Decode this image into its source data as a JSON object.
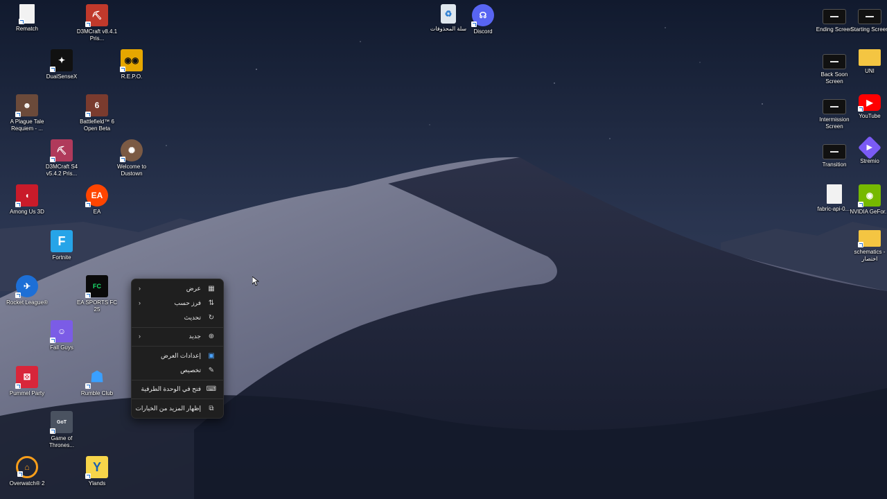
{
  "desktop": {
    "icons": [
      {
        "label": "Rematch",
        "icon": "file-icon"
      },
      {
        "label": "D3MCraft v8.4.1 Pris...",
        "icon": "d3mcraft-icon"
      },
      {
        "label": "DualSenseX",
        "icon": "dualsensex-icon"
      },
      {
        "label": "R.E.P.O.",
        "icon": "repo-icon"
      },
      {
        "label": "A Plague Tale Requiem - ...",
        "icon": "plague-tale-icon"
      },
      {
        "label": "Battlefield™ 6 Open Beta",
        "icon": "battlefield-icon"
      },
      {
        "label": "D3MCraft S4 v5.4.2 Pris...",
        "icon": "d3mcraft-icon"
      },
      {
        "label": "Welcome to Dustown",
        "icon": "dustown-icon"
      },
      {
        "label": "Among Us 3D",
        "icon": "among-us-icon"
      },
      {
        "label": "EA",
        "icon": "ea-icon"
      },
      {
        "label": "Fortnite",
        "icon": "fortnite-icon"
      },
      {
        "label": "Rocket League®",
        "icon": "rocket-league-icon"
      },
      {
        "label": "EA SPORTS FC 25",
        "icon": "fc25-icon"
      },
      {
        "label": "Fall Guys",
        "icon": "fall-guys-icon"
      },
      {
        "label": "Pummel Party",
        "icon": "pummel-party-icon"
      },
      {
        "label": "Rumble Club",
        "icon": "rumble-club-icon"
      },
      {
        "label": "Game of Thrones...",
        "icon": "game-of-thrones-icon"
      },
      {
        "label": "Overwatch® 2",
        "icon": "overwatch-icon"
      },
      {
        "label": "Ylands",
        "icon": "ylands-icon"
      },
      {
        "label": "سلة المحذوفات",
        "icon": "recycle-bin-icon"
      },
      {
        "label": "Discord",
        "icon": "discord-icon"
      },
      {
        "label": "Ending Screen",
        "icon": "video-file-icon"
      },
      {
        "label": "Starting Screen",
        "icon": "video-file-icon"
      },
      {
        "label": "Back Soon Screen",
        "icon": "video-file-icon"
      },
      {
        "label": "UNI",
        "icon": "folder-icon"
      },
      {
        "label": "Intermission Screen",
        "icon": "video-file-icon"
      },
      {
        "label": "YouTube",
        "icon": "youtube-icon"
      },
      {
        "label": "Transition",
        "icon": "video-file-icon"
      },
      {
        "label": "Stremio",
        "icon": "stremio-icon"
      },
      {
        "label": "fabric-api-0....",
        "icon": "file-icon"
      },
      {
        "label": "NVIDIA GeFor...",
        "icon": "nvidia-icon"
      },
      {
        "label": "schematics - اختصار",
        "icon": "folder-icon"
      }
    ]
  },
  "context_menu": {
    "view": "عرض",
    "sort_by": "فرز حسب",
    "refresh": "تحديث",
    "new": "جديد",
    "display_settings": "إعدادات العرض",
    "personalize": "تخصيص",
    "open_in_terminal": "فتح في الوحدة الطرفية",
    "show_more_options": "إظهار المزيد من الخيارات"
  },
  "colors": {
    "menu_bg": "#1f1f1f",
    "discord": "#5865f2",
    "youtube": "#ff0000",
    "nvidia": "#76b900",
    "folder": "#f4c542",
    "ea": "#ff4500"
  }
}
